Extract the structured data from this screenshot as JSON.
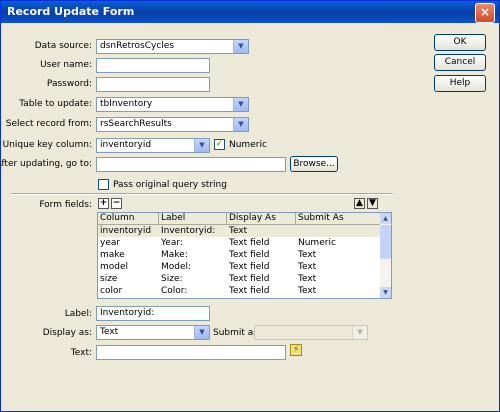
{
  "window": {
    "title": "Record Update Form"
  },
  "labels": {
    "data_source": "Data source:",
    "user_name": "User name:",
    "password": "Password:",
    "table": "Table to update:",
    "select_record": "Select record from:",
    "unique_key": "Unique key column:",
    "numeric": "Numeric",
    "after_updating": "After updating, go to:",
    "pass_query": "Pass original query string",
    "form_fields": "Form fields:",
    "label": "Label:",
    "display_as": "Display as:",
    "submit_as": "Submit as:",
    "text": "Text:"
  },
  "values": {
    "data_source": "dsnRetrosCycles",
    "user_name": "",
    "password": "",
    "table": "tbInventory",
    "select_record": "rsSearchResults",
    "unique_key": "inventoryid",
    "after_updating": "",
    "label": "Inventoryid:",
    "display_as": "Text",
    "submit_as": "",
    "text": ""
  },
  "state": {
    "numeric_checked": true,
    "pass_query_checked": false
  },
  "buttons": {
    "ok": "OK",
    "cancel": "Cancel",
    "help": "Help",
    "browse": "Browse..."
  },
  "grid": {
    "columns": [
      "Column",
      "Label",
      "Display As",
      "Submit As"
    ],
    "rows": [
      [
        "inventoryid",
        "Inventoryid:",
        "Text",
        ""
      ],
      [
        "year",
        "Year:",
        "Text field",
        "Numeric"
      ],
      [
        "make",
        "Make:",
        "Text field",
        "Text"
      ],
      [
        "model",
        "Model:",
        "Text field",
        "Text"
      ],
      [
        "size",
        "Size:",
        "Text field",
        "Text"
      ],
      [
        "color",
        "Color:",
        "Text field",
        "Text"
      ]
    ]
  },
  "icons": {
    "add": "plus-icon",
    "remove": "minus-icon",
    "up": "arrow-up-icon",
    "down": "arrow-down-icon",
    "dynamic": "lightning-icon"
  },
  "colors": {
    "titlebar": "#0a3fa6",
    "dialog": "#ece9d8",
    "check": "#21a121"
  }
}
